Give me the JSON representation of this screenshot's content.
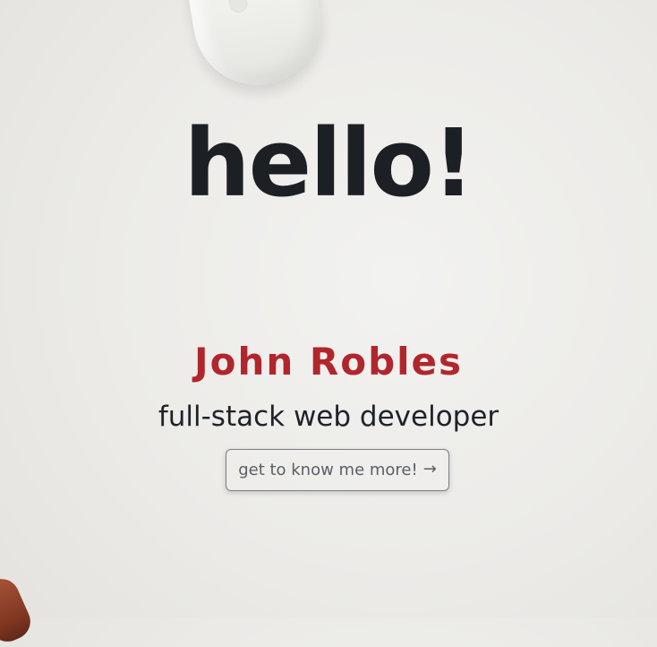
{
  "hero": {
    "title": "hello!"
  },
  "profile": {
    "name": "John Robles",
    "role": "full-stack web developer"
  },
  "cta": {
    "label": "get to know me more!",
    "arrow": "→"
  },
  "colors": {
    "name_accent": "#b1262d",
    "title": "#1c2024",
    "button_text": "#5a5f65",
    "button_border": "#7b7f83"
  },
  "icons": {
    "mouse": "computer-mouse-image",
    "wood": "wood-corner-image",
    "arrow": "arrow-right-icon"
  }
}
